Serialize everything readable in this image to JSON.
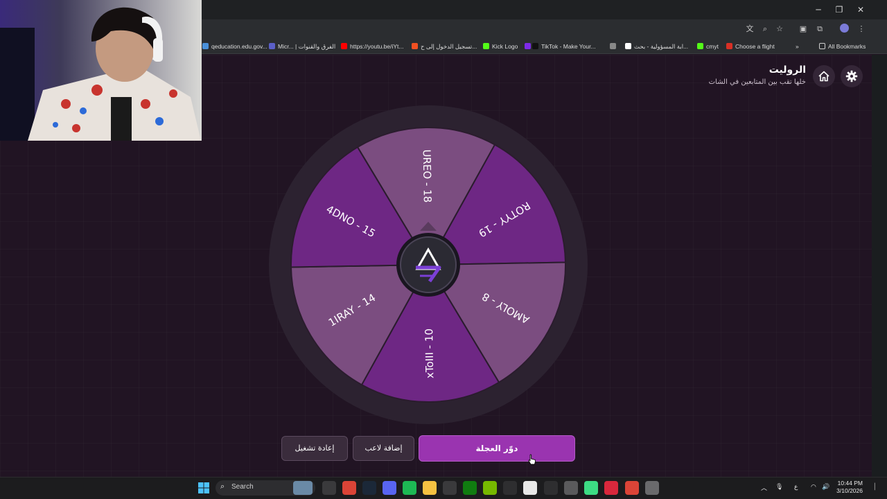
{
  "browser": {
    "bookmarks": [
      {
        "label": "qeducation.edu.gov...",
        "icon": "globe-icon",
        "color": "#4a90d9"
      },
      {
        "label": "Micr... | الفرق والقنوات",
        "icon": "teams-icon",
        "color": "#5b5fc7"
      },
      {
        "label": "https://youtu.be/iYt...",
        "icon": "youtube-icon",
        "color": "#ff0000"
      },
      {
        "label": "تسجيل الدخول إلى ح...",
        "icon": "microsoft-icon",
        "color": "#f25022"
      },
      {
        "label": "Kick Logo",
        "icon": "kick-icon",
        "color": "#53fc18"
      },
      {
        "label": "",
        "icon": "canva-icon",
        "color": "#7d2ae8"
      },
      {
        "label": "TikTok - Make Your...",
        "icon": "tiktok-icon",
        "color": "#111111"
      },
      {
        "label": "",
        "icon": "download-icon",
        "color": "#888888"
      },
      {
        "label": "ابة المسؤولية - بحث...",
        "icon": "google-icon",
        "color": "#ffffff"
      },
      {
        "label": "cmyt",
        "icon": "kick-icon",
        "color": "#53fc18"
      },
      {
        "label": "Choose a flight",
        "icon": "flight-icon",
        "color": "#d93025"
      }
    ],
    "all_bookmarks": "All Bookmarks"
  },
  "header": {
    "title": "الروليت",
    "subtitle": "خلها تقب بين المتابعين في الشات"
  },
  "wheel": {
    "segments": [
      {
        "label": "UREO - 18",
        "color": "#7b4d80"
      },
      {
        "label": "ROTYY - 19",
        "color": "#6e2784"
      },
      {
        "label": "AMOLY - 8",
        "color": "#7b4d80"
      },
      {
        "label": "xToIII - 10",
        "color": "#6e2784"
      },
      {
        "label": "1IRAY - 14",
        "color": "#7b4d80"
      },
      {
        "label": "4DNO - 15",
        "color": "#6e2784"
      }
    ],
    "rim_color": "#2c2230",
    "hub_color": "#7b3fd6"
  },
  "buttons": {
    "restart": "إعادة تشغيل",
    "add_player": "إضافة لاعب",
    "spin": "دوّر العجلة"
  },
  "taskbar": {
    "search": "Search",
    "lang": "ع",
    "time": "10:44 PM",
    "date": "3/10/2026"
  }
}
